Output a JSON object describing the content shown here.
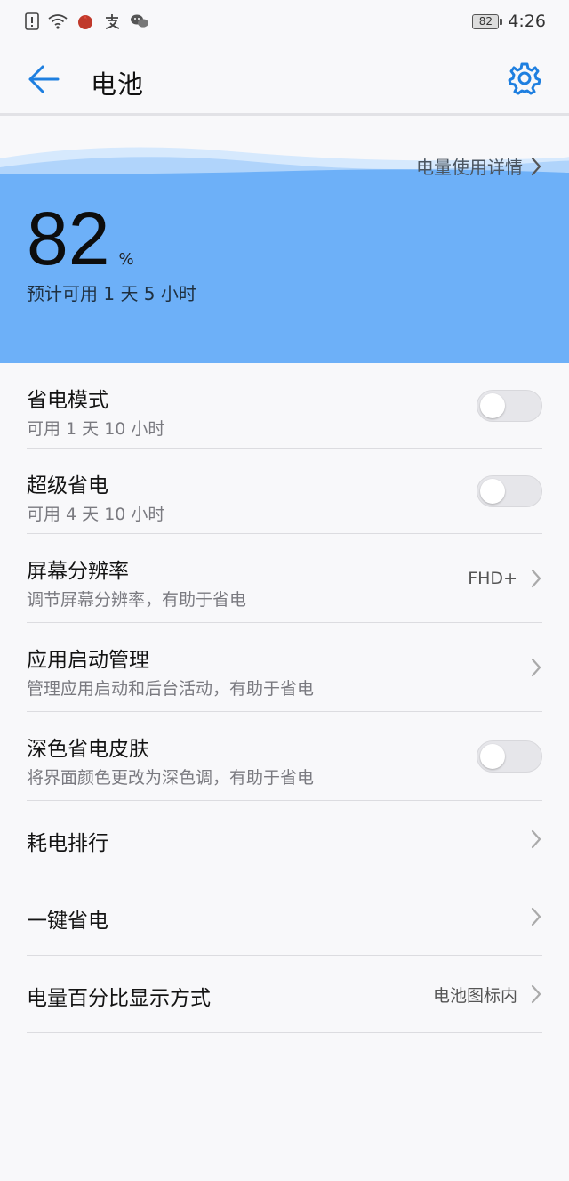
{
  "status_bar": {
    "time": "4:26",
    "battery_level": "82",
    "icons": [
      "alert-icon",
      "wifi-icon",
      "huawei-app-icon",
      "alipay-icon",
      "wechat-icon"
    ]
  },
  "header": {
    "title": "电池",
    "back_icon": "arrow-left-icon",
    "settings_icon": "gear-icon"
  },
  "battery": {
    "usage_link": "电量使用详情",
    "percent": "82",
    "percent_unit": "%",
    "estimate": "预计可用 1 天 5 小时"
  },
  "settings": [
    {
      "title": "省电模式",
      "subtitle": "可用 1 天 10 小时",
      "control": "toggle",
      "on": false
    },
    {
      "title": "超级省电",
      "subtitle": "可用 4 天 10 小时",
      "control": "toggle",
      "on": false
    },
    {
      "title": "屏幕分辨率",
      "subtitle": "调节屏幕分辨率，有助于省电",
      "control": "chevron",
      "value": "FHD+"
    },
    {
      "title": "应用启动管理",
      "subtitle": "管理应用启动和后台活动，有助于省电",
      "control": "chevron"
    },
    {
      "title": "深色省电皮肤",
      "subtitle": "将界面颜色更改为深色调，有助于省电",
      "control": "toggle",
      "on": false
    },
    {
      "title": "耗电排行",
      "control": "chevron"
    },
    {
      "title": "一键省电",
      "control": "chevron"
    },
    {
      "title": "电量百分比显示方式",
      "control": "chevron",
      "value": "电池图标内"
    }
  ],
  "colors": {
    "accent": "#1e7fe0",
    "hero_blue": "#6db0f8",
    "toggle_off": "#e6e6ea"
  }
}
